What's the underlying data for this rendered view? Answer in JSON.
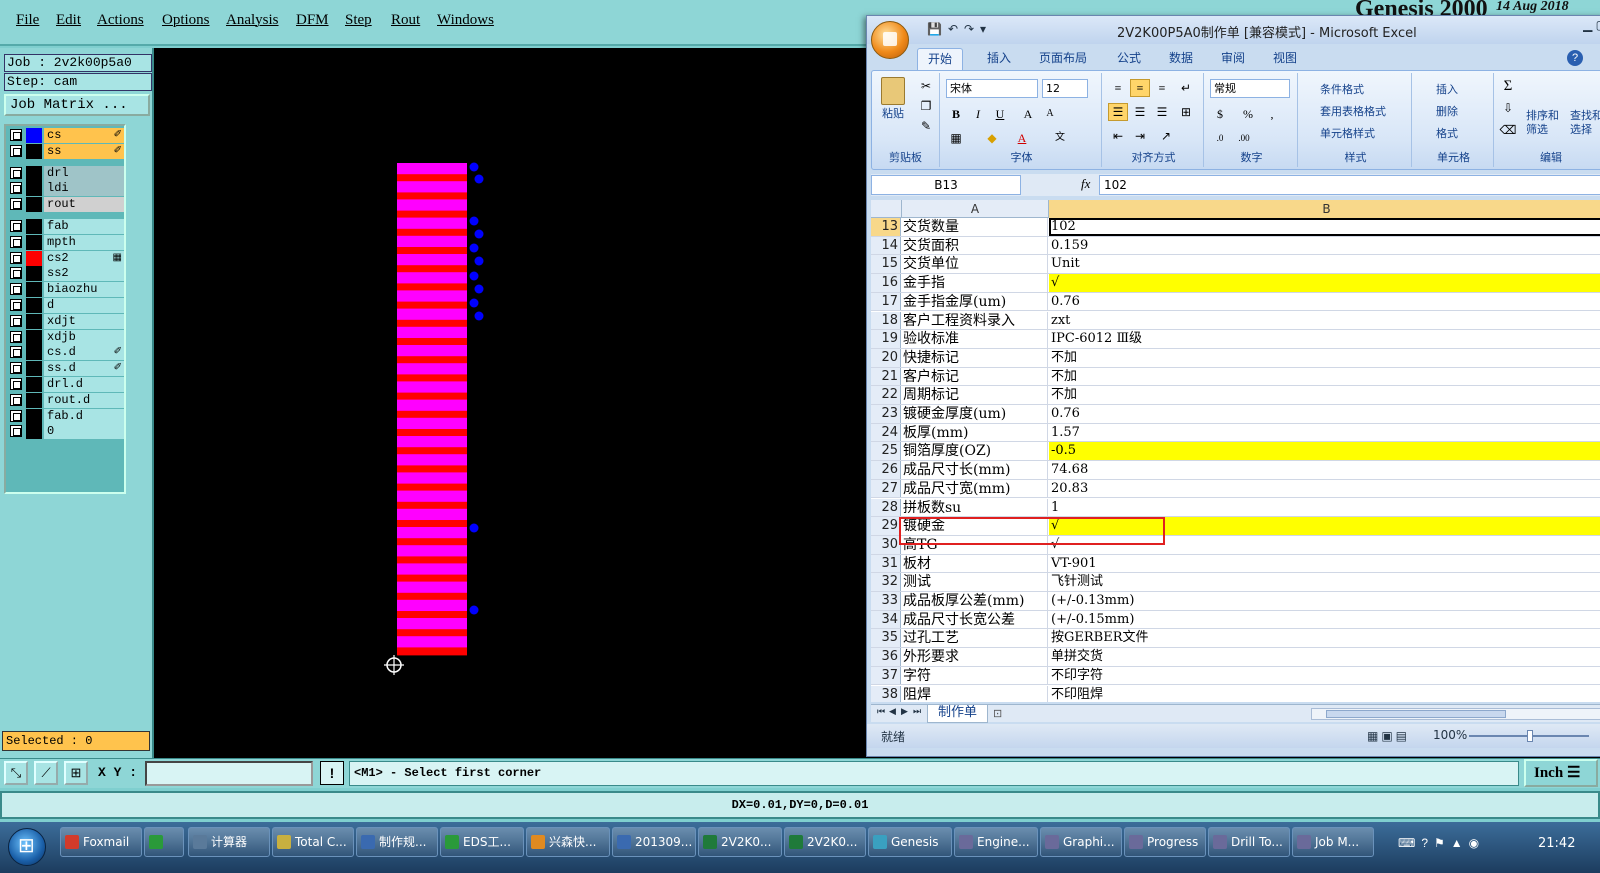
{
  "genesis": {
    "menu": [
      "File",
      "Edit",
      "Actions",
      "Options",
      "Analysis",
      "DFM",
      "Step",
      "Rout",
      "Windows"
    ],
    "brand": "Genesis 2000",
    "date": "14 Aug 2018",
    "job_label": "Job : 2v2k00p5a0",
    "step_label": "Step: cam",
    "job_matrix_button": "Job Matrix ...",
    "layers": [
      {
        "name": "cs",
        "type": "board",
        "swatch": "#0000ff",
        "mark": "✐"
      },
      {
        "name": "ss",
        "type": "board",
        "swatch": "#000000",
        "mark": "✐"
      },
      {
        "name": "drl",
        "type": "drill",
        "swatch": "#000000",
        "mark": ""
      },
      {
        "name": "ldi",
        "type": "drill",
        "swatch": "#000000",
        "mark": ""
      },
      {
        "name": "rout",
        "type": "rout",
        "swatch": "#000000",
        "mark": ""
      },
      {
        "name": "fab",
        "type": "misc",
        "swatch": "#000000",
        "mark": ""
      },
      {
        "name": "mpth",
        "type": "misc",
        "swatch": "#000000",
        "mark": ""
      },
      {
        "name": "cs2",
        "type": "misc",
        "swatch": "#ff0000",
        "mark": "▦"
      },
      {
        "name": "ss2",
        "type": "misc",
        "swatch": "#000000",
        "mark": ""
      },
      {
        "name": "biaozhu",
        "type": "misc",
        "swatch": "#000000",
        "mark": ""
      },
      {
        "name": "d",
        "type": "misc",
        "swatch": "#000000",
        "mark": ""
      },
      {
        "name": "xdjt",
        "type": "misc",
        "swatch": "#000000",
        "mark": ""
      },
      {
        "name": "xdjb",
        "type": "misc",
        "swatch": "#000000",
        "mark": ""
      },
      {
        "name": "cs.d",
        "type": "misc",
        "swatch": "#000000",
        "mark": "✐"
      },
      {
        "name": "ss.d",
        "type": "misc",
        "swatch": "#000000",
        "mark": "✐"
      },
      {
        "name": "drl.d",
        "type": "misc",
        "swatch": "#000000",
        "mark": ""
      },
      {
        "name": "rout.d",
        "type": "misc",
        "swatch": "#000000",
        "mark": ""
      },
      {
        "name": "fab.d",
        "type": "misc",
        "swatch": "#000000",
        "mark": ""
      },
      {
        "name": "0",
        "type": "misc",
        "swatch": "#000000",
        "mark": ""
      }
    ],
    "selected_label": "Selected : 0",
    "xy_label": "X Y :",
    "xy_value": "",
    "warn_label": "!",
    "prompt": "<M1> - Select first corner",
    "unit_button": "Inch",
    "status": "DX=0.01,DY=0,D=0.01",
    "colors": {
      "pad_fill": "#ff00ff",
      "pad_gap": "#ff0000",
      "drill_dots": "#0000ff",
      "canvas": "#000000"
    }
  },
  "excel": {
    "title": "2V2K00P5A0制作单 [兼容模式] - Microsoft Excel",
    "tabs": [
      "开始",
      "插入",
      "页面布局",
      "公式",
      "数据",
      "审阅",
      "视图"
    ],
    "ribbon": {
      "paste": "粘贴",
      "clipboard": "剪贴板",
      "font_name": "宋体",
      "font_size": "12",
      "font_group": "字体",
      "align_group": "对齐方式",
      "number_format": "常规",
      "number_group": "数字",
      "conditional_format": "条件格式",
      "table_format": "套用表格格式",
      "cell_style": "单元格样式",
      "style_group": "样式",
      "insert": "插入",
      "delete": "删除",
      "format": "格式",
      "cells_group": "单元格",
      "sort_filter": "排序和\n筛选",
      "find_select": "查找和\n选择",
      "edit_group": "编辑"
    },
    "name_box": "B13",
    "fx": "fx",
    "formula": "102",
    "columns": [
      "A",
      "B"
    ],
    "rows": [
      {
        "n": "13",
        "a": "交货数量",
        "b": "102",
        "yellow": false
      },
      {
        "n": "14",
        "a": "交货面积",
        "b": "0.159",
        "yellow": false
      },
      {
        "n": "15",
        "a": "交货单位",
        "b": "Unit",
        "yellow": false
      },
      {
        "n": "16",
        "a": "金手指",
        "b": "√",
        "yellow": true
      },
      {
        "n": "17",
        "a": "金手指金厚(um)",
        "b": "0.76",
        "yellow": false
      },
      {
        "n": "18",
        "a": "客户工程资料录入",
        "b": "zxt",
        "yellow": false
      },
      {
        "n": "19",
        "a": "验收标准",
        "b": "IPC-6012 Ⅲ级",
        "yellow": false
      },
      {
        "n": "20",
        "a": "快捷标记",
        "b": "不加",
        "yellow": false
      },
      {
        "n": "21",
        "a": "客户标记",
        "b": "不加",
        "yellow": false
      },
      {
        "n": "22",
        "a": "周期标记",
        "b": "不加",
        "yellow": false
      },
      {
        "n": "23",
        "a": "镀硬金厚度(um)",
        "b": "0.76",
        "yellow": false
      },
      {
        "n": "24",
        "a": "板厚(mm)",
        "b": "1.57",
        "yellow": false
      },
      {
        "n": "25",
        "a": "铜箔厚度(OZ)",
        "b": "-0.5",
        "yellow": true
      },
      {
        "n": "26",
        "a": "成品尺寸长(mm)",
        "b": "74.68",
        "yellow": false
      },
      {
        "n": "27",
        "a": "成品尺寸宽(mm)",
        "b": "20.83",
        "yellow": false
      },
      {
        "n": "28",
        "a": "拼板数su",
        "b": "1",
        "yellow": false
      },
      {
        "n": "29",
        "a": "镀硬金",
        "b": "√",
        "yellow": true
      },
      {
        "n": "30",
        "a": "高TG",
        "b": "√",
        "yellow": false
      },
      {
        "n": "31",
        "a": "板材",
        "b": "VT-901",
        "yellow": false
      },
      {
        "n": "32",
        "a": "测试",
        "b": "飞针测试",
        "yellow": false
      },
      {
        "n": "33",
        "a": "成品板厚公差(mm)",
        "b": "(+/-0.13mm)",
        "yellow": false
      },
      {
        "n": "34",
        "a": "成品尺寸长宽公差",
        "b": "(+/-0.15mm)",
        "yellow": false
      },
      {
        "n": "35",
        "a": "过孔工艺",
        "b": "按GERBER文件",
        "yellow": false
      },
      {
        "n": "36",
        "a": "外形要求",
        "b": "单拼交货",
        "yellow": false
      },
      {
        "n": "37",
        "a": "字符",
        "b": "不印字符",
        "yellow": false
      },
      {
        "n": "38",
        "a": "阻焊",
        "b": "不印阻焊",
        "yellow": false
      }
    ],
    "sheet_tab": "制作单",
    "status_ready": "就绪",
    "zoom": "100%",
    "colors": {
      "highlight": "#ffff00",
      "annotation": "#e02020",
      "header_selected": "#f8d88a"
    }
  },
  "taskbar": {
    "items": [
      {
        "label": "Foxmail",
        "color": "#d23b2b"
      },
      {
        "label": "",
        "color": "#2a9a3a"
      },
      {
        "label": "计算器",
        "color": "#5a7a9a"
      },
      {
        "label": "Total C...",
        "color": "#c8b040"
      },
      {
        "label": "制作规...",
        "color": "#3a6ab0"
      },
      {
        "label": "EDS工...",
        "color": "#2a9a3a"
      },
      {
        "label": "兴森快...",
        "color": "#e08a20"
      },
      {
        "label": "201309...",
        "color": "#3a6ab0"
      },
      {
        "label": "2V2K0...",
        "color": "#1f7a3a"
      },
      {
        "label": "2V2K0...",
        "color": "#1f7a3a"
      },
      {
        "label": "Genesis",
        "color": "#3aa0c0"
      },
      {
        "label": "Engine...",
        "color": "#6a6a9a"
      },
      {
        "label": "Graphi...",
        "color": "#6a6a9a"
      },
      {
        "label": "Progress",
        "color": "#6a6a9a"
      },
      {
        "label": "Drill To...",
        "color": "#6a6a9a"
      },
      {
        "label": "Job M...",
        "color": "#6a6a9a"
      }
    ],
    "clock": "21:42"
  }
}
